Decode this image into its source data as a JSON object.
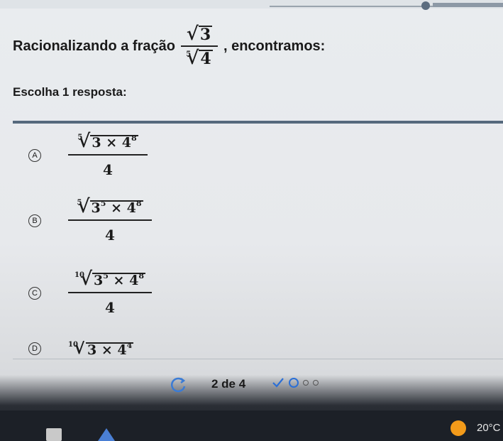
{
  "question": {
    "prefix": "Racionalizando a fração",
    "fraction": {
      "numerator": "√3",
      "num_radicand": "3",
      "denominator_index": "5",
      "denominator_radicand": "4"
    },
    "suffix": ", encontramos:"
  },
  "instruction": "Escolha 1 resposta:",
  "options": [
    {
      "letter": "A",
      "index": "5",
      "base1": "3",
      "exp1": "",
      "times": "×",
      "base2": "4",
      "exp2": "8",
      "denominator": "4"
    },
    {
      "letter": "B",
      "index": "5",
      "base1": "3",
      "exp1": "5",
      "times": "×",
      "base2": "4",
      "exp2": "8",
      "denominator": "4"
    },
    {
      "letter": "C",
      "index": "10",
      "base1": "3",
      "exp1": "5",
      "times": "×",
      "base2": "4",
      "exp2": "8",
      "denominator": "4"
    },
    {
      "letter": "D",
      "index": "10",
      "base1": "3",
      "exp1": "",
      "times": "×",
      "base2": "4",
      "exp2": "4",
      "denominator": ""
    }
  ],
  "footer": {
    "page_text": "2 de 4",
    "progress": [
      "done",
      "current",
      "todo",
      "todo"
    ]
  },
  "taskbar": {
    "temperature": "20°C"
  }
}
